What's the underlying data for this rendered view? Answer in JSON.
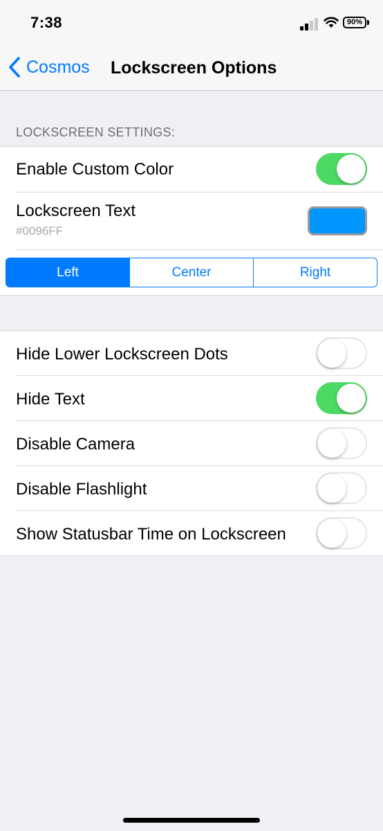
{
  "status": {
    "time": "7:38",
    "battery": "90%"
  },
  "nav": {
    "back_label": "Cosmos",
    "title": "Lockscreen Options"
  },
  "section1": {
    "header": "LOCKSCREEN SETTINGS:",
    "enable_custom_color": {
      "label": "Enable Custom Color",
      "on": true
    },
    "lockscreen_text": {
      "label": "Lockscreen Text",
      "value": "#0096FF",
      "color": "#0096FF"
    },
    "alignment": {
      "options": [
        "Left",
        "Center",
        "Right"
      ],
      "selected": "Left"
    }
  },
  "section2": {
    "items": [
      {
        "label": "Hide Lower Lockscreen Dots",
        "on": false
      },
      {
        "label": "Hide Text",
        "on": true
      },
      {
        "label": "Disable Camera",
        "on": false
      },
      {
        "label": "Disable Flashlight",
        "on": false
      },
      {
        "label": "Show Statusbar Time on Lockscreen",
        "on": false
      }
    ]
  },
  "colors": {
    "accent": "#007AFF",
    "toggle_on": "#4CD964",
    "background": "#EFEFF4"
  }
}
